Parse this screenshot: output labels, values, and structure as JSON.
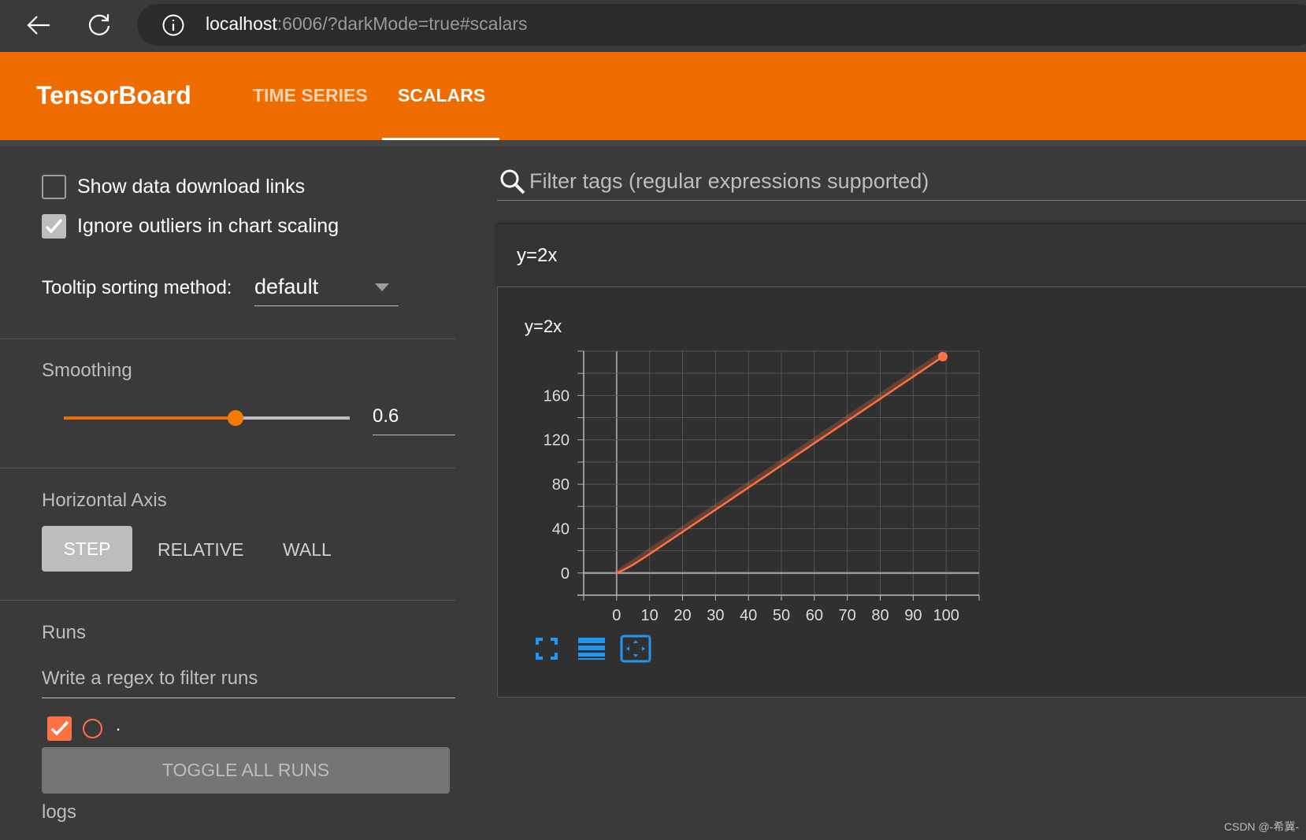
{
  "browser": {
    "url_host": "localhost",
    "url_rest": ":6006/?darkMode=true#scalars",
    "icons": [
      "back-arrow-icon",
      "reload-icon",
      "info-icon"
    ]
  },
  "header": {
    "brand": "TensorBoard",
    "tabs": [
      {
        "label": "TIME SERIES",
        "active": false
      },
      {
        "label": "SCALARS",
        "active": true
      }
    ],
    "color": "#ef6c00"
  },
  "sidebar": {
    "show_download_links": {
      "label": "Show data download links",
      "checked": false
    },
    "ignore_outliers": {
      "label": "Ignore outliers in chart scaling",
      "checked": true
    },
    "tooltip_sort": {
      "label": "Tooltip sorting method:",
      "value": "default"
    },
    "smoothing": {
      "label": "Smoothing",
      "value": "0.6",
      "fraction": 0.6
    },
    "horizontal_axis": {
      "label": "Horizontal Axis",
      "options": [
        "STEP",
        "RELATIVE",
        "WALL"
      ],
      "selected": "STEP"
    },
    "runs": {
      "label": "Runs",
      "filter_placeholder": "Write a regex to filter runs",
      "items": [
        {
          "name": ".",
          "checked": true,
          "color": "#ff7043"
        }
      ],
      "toggle_label": "TOGGLE ALL RUNS",
      "group": "logs"
    }
  },
  "main": {
    "filter_placeholder": "Filter tags (regular expressions supported)",
    "card_title": "y=2x",
    "chart_icons": [
      "fit-screen-icon",
      "toggle-y-log-icon",
      "fit-domain-icon"
    ]
  },
  "watermark": "CSDN @-希冀-",
  "chart_data": {
    "type": "line",
    "title": "y=2x",
    "xlabel": "",
    "ylabel": "",
    "xlim": [
      -10,
      110
    ],
    "ylim": [
      -20,
      200
    ],
    "xticks": [
      0,
      10,
      20,
      30,
      40,
      50,
      60,
      70,
      80,
      90,
      100
    ],
    "yticks": [
      0,
      40,
      80,
      120,
      160
    ],
    "grid": true,
    "smoothing": 0.6,
    "color": "#ff7043",
    "series": [
      {
        "name": ".",
        "x": [
          0,
          1,
          2,
          3,
          4,
          5,
          6,
          7,
          8,
          9,
          10,
          11,
          12,
          13,
          14,
          15,
          16,
          17,
          18,
          19,
          20,
          21,
          22,
          23,
          24,
          25,
          26,
          27,
          28,
          29,
          30,
          31,
          32,
          33,
          34,
          35,
          36,
          37,
          38,
          39,
          40,
          41,
          42,
          43,
          44,
          45,
          46,
          47,
          48,
          49,
          50,
          51,
          52,
          53,
          54,
          55,
          56,
          57,
          58,
          59,
          60,
          61,
          62,
          63,
          64,
          65,
          66,
          67,
          68,
          69,
          70,
          71,
          72,
          73,
          74,
          75,
          76,
          77,
          78,
          79,
          80,
          81,
          82,
          83,
          84,
          85,
          86,
          87,
          88,
          89,
          90,
          91,
          92,
          93,
          94,
          95,
          96,
          97,
          98,
          99
        ],
        "y": [
          0,
          2,
          4,
          6,
          8,
          10,
          12,
          14,
          16,
          18,
          20,
          22,
          24,
          26,
          28,
          30,
          32,
          34,
          36,
          38,
          40,
          42,
          44,
          46,
          48,
          50,
          52,
          54,
          56,
          58,
          60,
          62,
          64,
          66,
          68,
          70,
          72,
          74,
          76,
          78,
          80,
          82,
          84,
          86,
          88,
          90,
          92,
          94,
          96,
          98,
          100,
          102,
          104,
          106,
          108,
          110,
          112,
          114,
          116,
          118,
          120,
          122,
          124,
          126,
          128,
          130,
          132,
          134,
          136,
          138,
          140,
          142,
          144,
          146,
          148,
          150,
          152,
          154,
          156,
          158,
          160,
          162,
          164,
          166,
          168,
          170,
          172,
          174,
          176,
          178,
          180,
          182,
          184,
          186,
          188,
          190,
          192,
          194,
          196,
          198
        ]
      }
    ]
  }
}
